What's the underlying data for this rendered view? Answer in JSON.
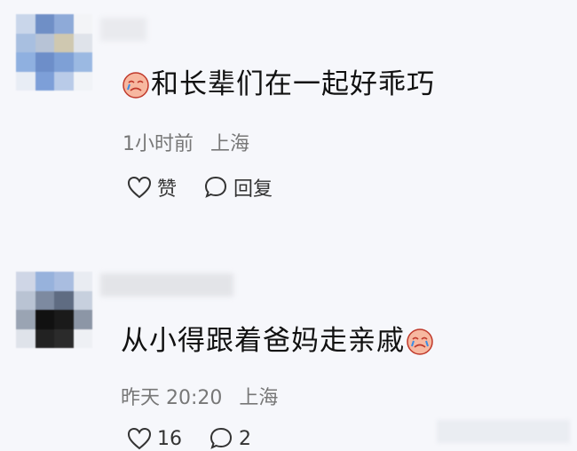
{
  "comments": [
    {
      "text": "和长辈们在一起好乖巧",
      "emoji": "crying-face-emoji",
      "time": "1小时前",
      "location": "上海",
      "like_label": "赞",
      "reply_label": "回复"
    },
    {
      "text": "从小得跟着爸妈走亲戚",
      "emoji": "crying-face-emoji",
      "time": "昨天 20:20",
      "location": "上海",
      "like_count": "16",
      "reply_count": "2"
    }
  ],
  "colors": {
    "background": "#f6f7fb",
    "meta_text": "#777777",
    "emoji_face": "#f7b8a0"
  }
}
